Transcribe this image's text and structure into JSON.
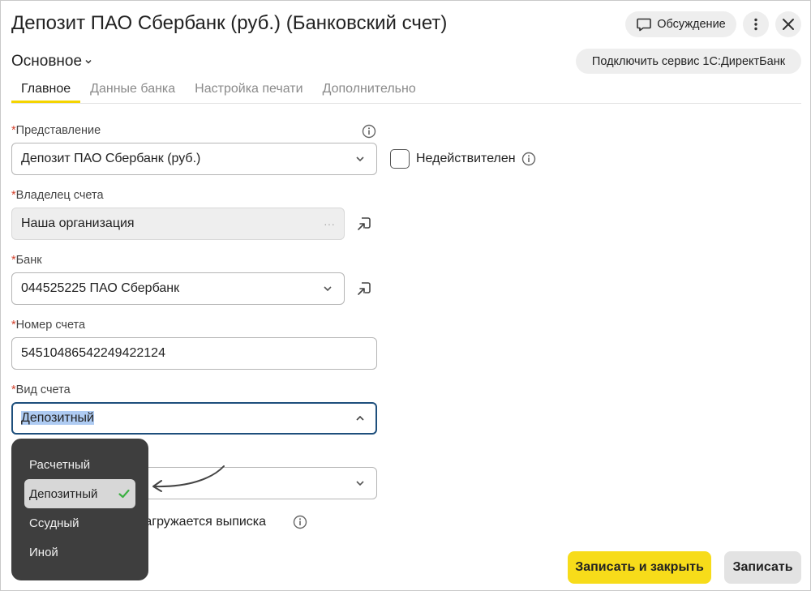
{
  "window": {
    "title": "Депозит ПАО Сбербанк (руб.) (Банковский счет)",
    "discussion_label": "Обсуждение",
    "direct_bank_label": "Подключить сервис 1С:ДиректБанк"
  },
  "section": {
    "label": "Основное"
  },
  "tabs": [
    {
      "label": "Главное",
      "active": true
    },
    {
      "label": "Данные банка",
      "active": false
    },
    {
      "label": "Настройка печати",
      "active": false
    },
    {
      "label": "Дополнительно",
      "active": false
    }
  ],
  "form": {
    "required_mark": "*",
    "representation": {
      "label": "Представление",
      "value": "Депозит ПАО Сбербанк (руб.)"
    },
    "invalid": {
      "label": "Недействителен",
      "checked": false
    },
    "owner": {
      "label": "Владелец счета",
      "value": "Наша организация",
      "ellipsis": "···"
    },
    "bank": {
      "label": "Банк",
      "value": "044525225 ПАО Сбербанк"
    },
    "account_number": {
      "label": "Номер счета",
      "value": "54510486542249422124"
    },
    "account_type": {
      "label": "Вид счета",
      "value": "Депозитный"
    },
    "statement_text": "загружается выписка"
  },
  "dropdown": {
    "options": [
      {
        "label": "Расчетный",
        "selected": false
      },
      {
        "label": "Депозитный",
        "selected": true
      },
      {
        "label": "Ссудный",
        "selected": false
      },
      {
        "label": "Иной",
        "selected": false
      }
    ]
  },
  "footer": {
    "save_close_label": "Записать и закрыть",
    "save_label": "Записать"
  },
  "colors": {
    "accent_yellow": "#f7dc1a",
    "focus_border": "#1e4f7c",
    "required": "#d2402b",
    "check_green": "#3cb043"
  }
}
